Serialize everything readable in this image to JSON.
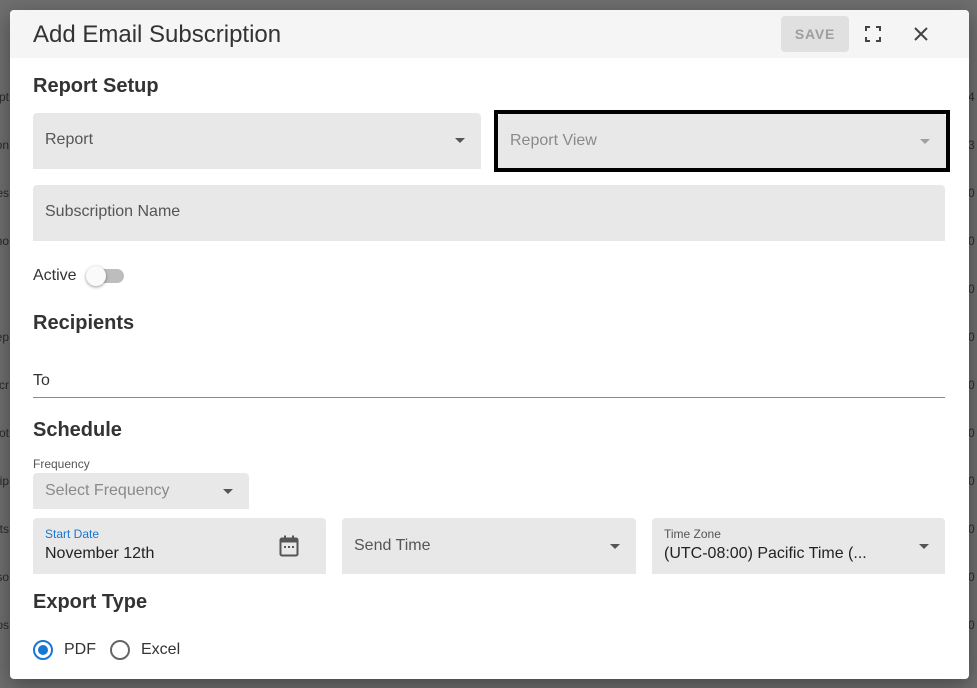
{
  "background": {
    "left_fragments": [
      "pt",
      "on",
      "es",
      "no",
      "",
      "ep",
      "cr",
      "ot",
      "rip",
      "ts",
      "so",
      "os"
    ],
    "right_fragments": [
      "4",
      "3",
      "0",
      "0",
      "0",
      "0",
      "0",
      "0",
      "1",
      "0",
      "0",
      "0",
      "0",
      "0"
    ]
  },
  "dialog": {
    "title": "Add Email Subscription",
    "save_label": "SAVE"
  },
  "report_setup": {
    "heading": "Report Setup",
    "report_placeholder": "Report",
    "report_view_placeholder": "Report View",
    "subscription_name_placeholder": "Subscription Name",
    "active_label": "Active",
    "active": false
  },
  "recipients": {
    "heading": "Recipients",
    "to_label": "To"
  },
  "schedule": {
    "heading": "Schedule",
    "frequency_label": "Frequency",
    "frequency_placeholder": "Select Frequency",
    "start_date_label": "Start Date",
    "start_date_value": "November 12th",
    "send_time_placeholder": "Send Time",
    "time_zone_label": "Time Zone",
    "time_zone_value": "(UTC-08:00) Pacific Time (..."
  },
  "export_type": {
    "heading": "Export Type",
    "options": [
      {
        "label": "PDF",
        "selected": true
      },
      {
        "label": "Excel",
        "selected": false
      }
    ]
  },
  "colors": {
    "accent": "#1976d2",
    "field_bg": "#e8e8e8",
    "header_bg": "#f5f5f5",
    "overlay": "#6e6e6e"
  },
  "icons": [
    "fullscreen-icon",
    "close-icon",
    "dropdown-arrow-icon",
    "calendar-icon"
  ]
}
